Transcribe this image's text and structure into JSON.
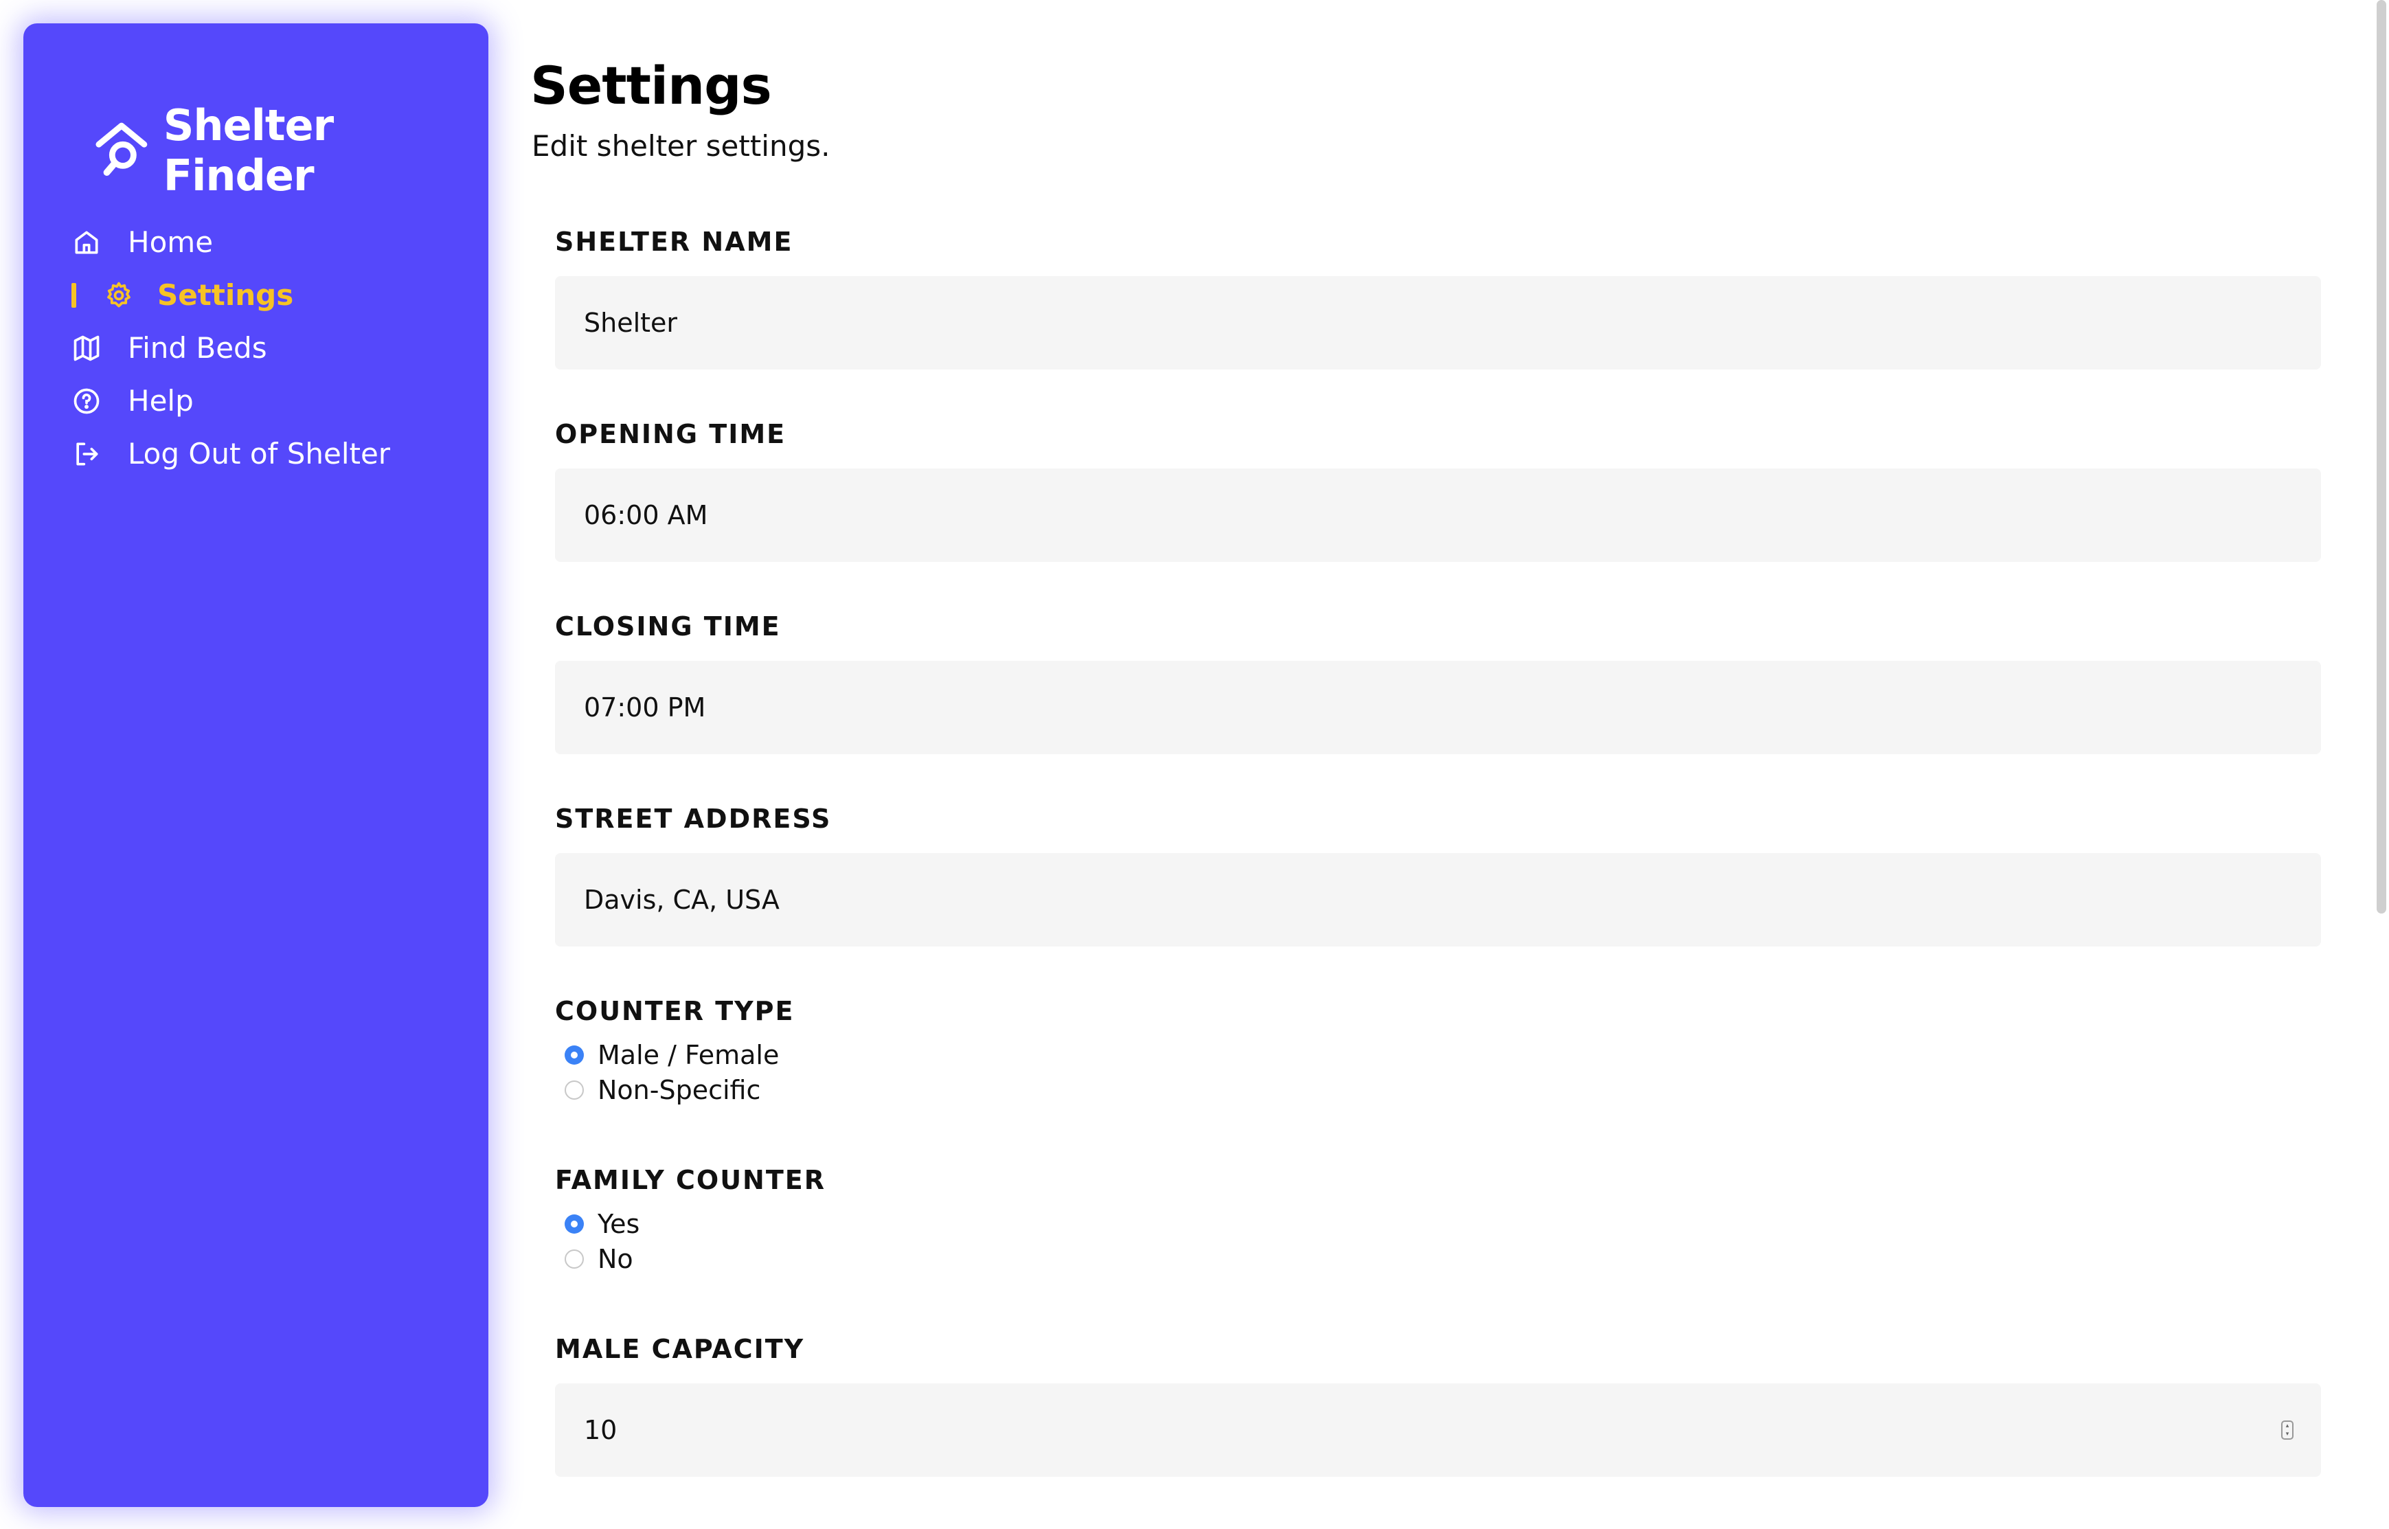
{
  "app": {
    "name": "Shelter Finder",
    "brand_color": "#5548fb",
    "active_color": "#f7c325"
  },
  "sidebar": {
    "items": [
      {
        "label": "Home",
        "icon": "home-icon",
        "active": false
      },
      {
        "label": "Settings",
        "icon": "gear-icon",
        "active": true
      },
      {
        "label": "Find Beds",
        "icon": "map-icon",
        "active": false
      },
      {
        "label": "Help",
        "icon": "help-circle-icon",
        "active": false
      },
      {
        "label": "Log Out of Shelter",
        "icon": "logout-icon",
        "active": false
      }
    ]
  },
  "page": {
    "title": "Settings",
    "subtitle": "Edit shelter settings."
  },
  "form": {
    "shelter_name": {
      "label": "SHELTER NAME",
      "value": "Shelter"
    },
    "opening_time": {
      "label": "OPENING TIME",
      "value": "06:00 AM"
    },
    "closing_time": {
      "label": "CLOSING TIME",
      "value": "07:00 PM"
    },
    "street_address": {
      "label": "STREET ADDRESS",
      "value": "Davis, CA, USA"
    },
    "counter_type": {
      "label": "COUNTER TYPE",
      "options": [
        {
          "label": "Male / Female",
          "selected": true
        },
        {
          "label": "Non-Specific",
          "selected": false
        }
      ]
    },
    "family_counter": {
      "label": "FAMILY COUNTER",
      "options": [
        {
          "label": "Yes",
          "selected": true
        },
        {
          "label": "No",
          "selected": false
        }
      ]
    },
    "male_capacity": {
      "label": "MALE CAPACITY",
      "value": "10"
    }
  }
}
